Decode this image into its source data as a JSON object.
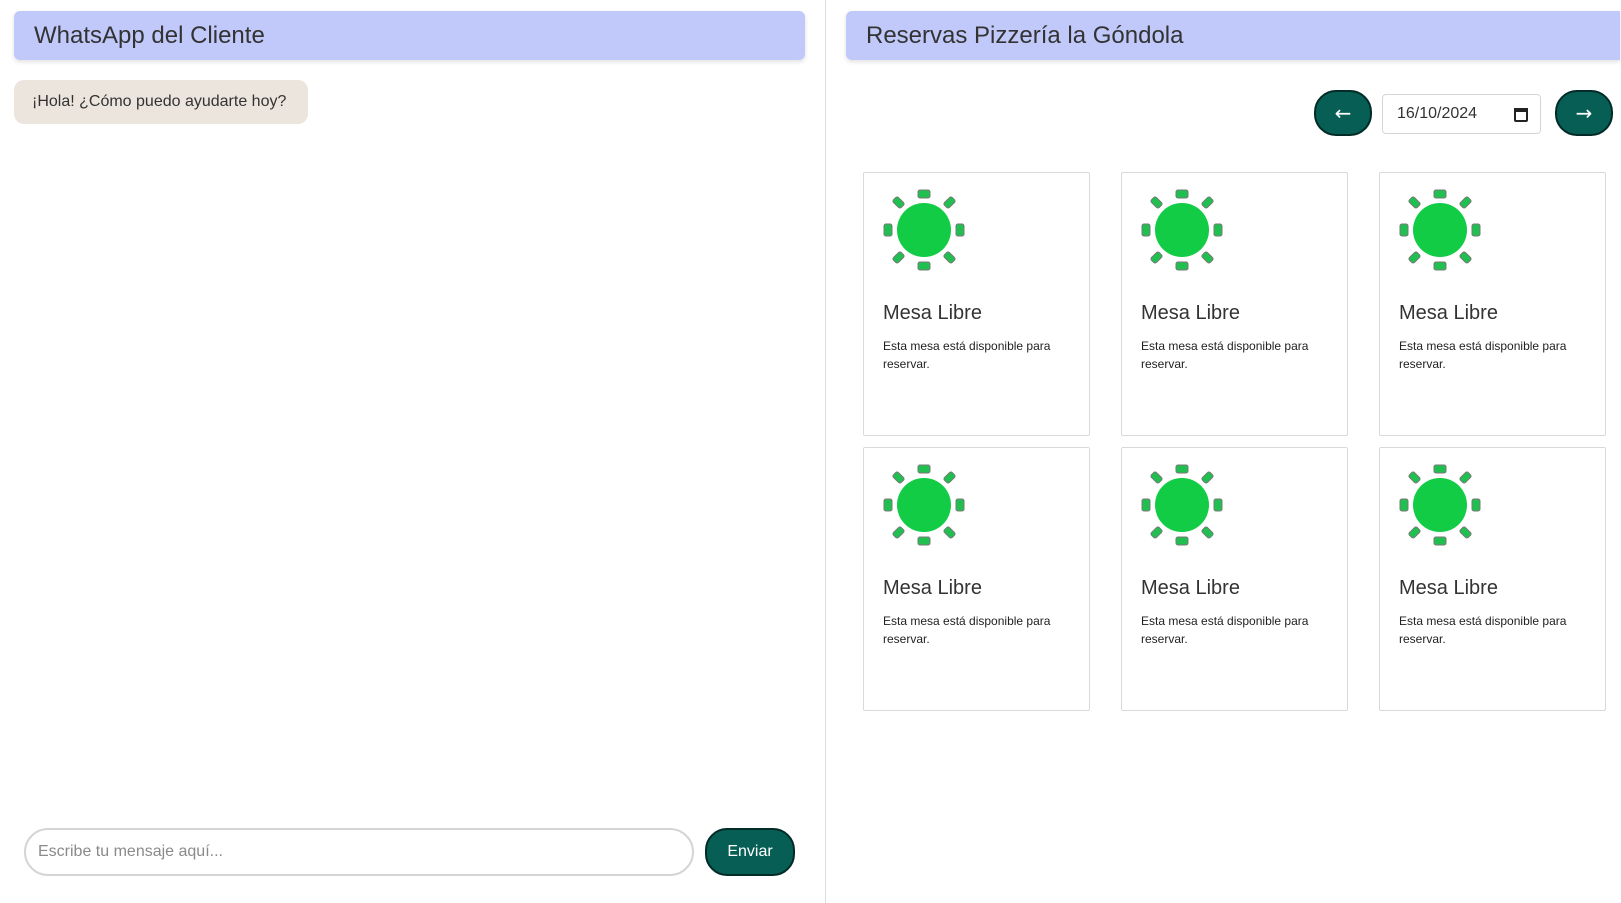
{
  "chat": {
    "title": "WhatsApp del Cliente",
    "messages": [
      {
        "text": "¡Hola! ¿Cómo puedo ayudarte hoy?"
      }
    ],
    "input": {
      "placeholder": "Escribe tu mensaje aquí...",
      "value": ""
    },
    "send_label": "Enviar"
  },
  "reservations": {
    "title": "Reservas Pizzería la Góndola",
    "prev_label": "←",
    "next_label": "→",
    "date": "16/10/2024",
    "tables": [
      {
        "status": "Mesa Libre",
        "description": "Esta mesa está disponible para reservar.",
        "icon": "round-table-green-icon"
      },
      {
        "status": "Mesa Libre",
        "description": "Esta mesa está disponible para reservar.",
        "icon": "round-table-green-icon"
      },
      {
        "status": "Mesa Libre",
        "description": "Esta mesa está disponible para reservar.",
        "icon": "round-table-green-icon"
      },
      {
        "status": "Mesa Libre",
        "description": "Esta mesa está disponible para reservar.",
        "icon": "round-table-green-icon"
      },
      {
        "status": "Mesa Libre",
        "description": "Esta mesa está disponible para reservar.",
        "icon": "round-table-green-icon"
      },
      {
        "status": "Mesa Libre",
        "description": "Esta mesa está disponible para reservar.",
        "icon": "round-table-green-icon"
      }
    ]
  },
  "colors": {
    "header_bg": "#c0c9fa",
    "bubble_bg": "#ece5dd",
    "button_bg": "#075e54",
    "button_border": "#002b27",
    "table_green": "#12cc45",
    "chair_green": "#20c050"
  }
}
